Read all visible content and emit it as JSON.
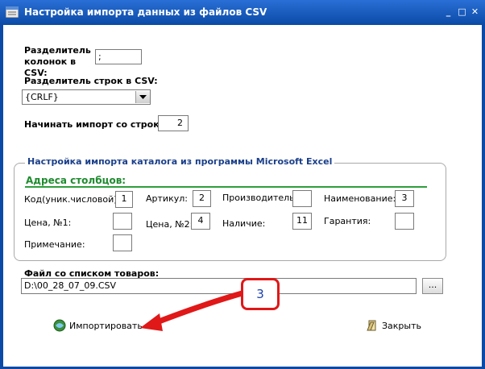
{
  "window": {
    "title": "Настройка импорта данных из файлов CSV",
    "minimize_glyph": "_",
    "maximize_glyph": "□",
    "close_glyph": "✕"
  },
  "csv": {
    "col_sep_label": "Разделитель колонок в CSV:",
    "col_sep_value": ";",
    "row_sep_label": "Разделитель строк в CSV:",
    "row_sep_value": "{CRLF}",
    "start_row_label": "Начинать импорт со строки:",
    "start_row_value": "2"
  },
  "excel_group": {
    "title": "Настройка импорта каталога из программы Microsoft Excel",
    "subtitle": "Адреса столбцов:",
    "fields": [
      {
        "label": "Код(уник.числовой)",
        "value": "1"
      },
      {
        "label": "Артикул:",
        "value": "2"
      },
      {
        "label": "Производитель:",
        "value": ""
      },
      {
        "label": "Наименование:",
        "value": "3"
      },
      {
        "label": "Цена, №1:",
        "value": ""
      },
      {
        "label": "Цена, №2:",
        "value": "4"
      },
      {
        "label": "Наличие:",
        "value": "11"
      },
      {
        "label": "Гарантия:",
        "value": ""
      },
      {
        "label": "Примечание:",
        "value": ""
      }
    ]
  },
  "file": {
    "label": "Файл со списком товаров:",
    "path": "D:\\00_28_07_09.CSV",
    "browse_label": "..."
  },
  "actions": {
    "import_label": "Импортировать",
    "close_label": "Закрыть"
  },
  "annotation": {
    "callout_number": "3"
  },
  "colors": {
    "title_bar": "#0b4aa6",
    "group_title": "#1a3f8a",
    "subtitle_green": "#1e8b2e",
    "annotation_red": "#e01818"
  }
}
